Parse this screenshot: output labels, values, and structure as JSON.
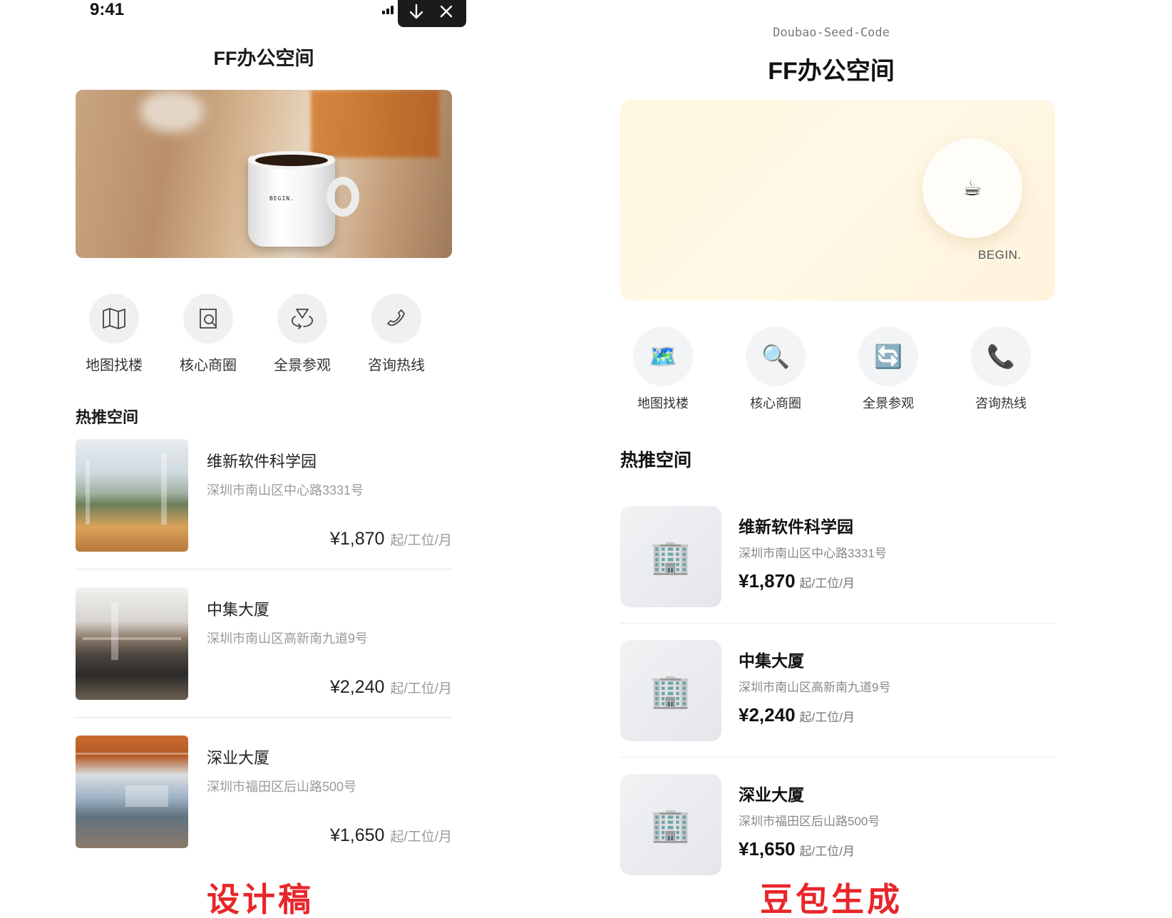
{
  "design": {
    "status_time": "9:41",
    "title": "FF办公空间",
    "hero_mug_text": "BEGIN.",
    "quick_actions": [
      {
        "label": "地图找楼",
        "icon": "map-icon"
      },
      {
        "label": "核心商圈",
        "icon": "search-doc-icon"
      },
      {
        "label": "全景参观",
        "icon": "panorama-icon"
      },
      {
        "label": "咨询热线",
        "icon": "phone-icon"
      }
    ],
    "section_title": "热推空间",
    "listings": [
      {
        "name": "维新软件科学园",
        "address": "深圳市南山区中心路3331号",
        "price": "¥1,870",
        "unit": "起/工位/月"
      },
      {
        "name": "中集大厦",
        "address": "深圳市南山区高新南九道9号",
        "price": "¥2,240",
        "unit": "起/工位/月"
      },
      {
        "name": "深业大厦",
        "address": "深圳市福田区后山路500号",
        "price": "¥1,650",
        "unit": "起/工位/月"
      }
    ],
    "caption": "设计稿"
  },
  "generated": {
    "subtitle": "Doubao-Seed-Code",
    "title": "FF办公空间",
    "hero_text": "BEGIN.",
    "hero_icon": "☕",
    "quick_actions": [
      {
        "label": "地图找楼",
        "icon": "🗺️"
      },
      {
        "label": "核心商圈",
        "icon": "🔍"
      },
      {
        "label": "全景参观",
        "icon": "🔄"
      },
      {
        "label": "咨询热线",
        "icon": "📞"
      }
    ],
    "section_title": "热推空间",
    "listing_icon": "🏢",
    "listings": [
      {
        "name": "维新软件科学园",
        "address": "深圳市南山区中心路3331号",
        "price": "¥1,870",
        "unit": "起/工位/月"
      },
      {
        "name": "中集大厦",
        "address": "深圳市南山区高新南九道9号",
        "price": "¥2,240",
        "unit": "起/工位/月"
      },
      {
        "name": "深业大厦",
        "address": "深圳市福田区后山路500号",
        "price": "¥1,650",
        "unit": "起/工位/月"
      }
    ],
    "caption": "豆包生成"
  }
}
